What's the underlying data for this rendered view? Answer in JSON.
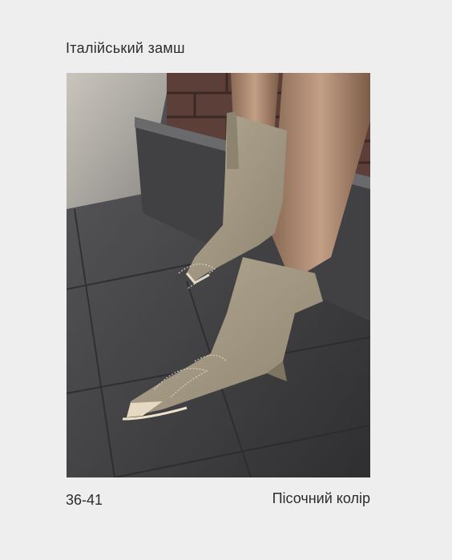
{
  "title": "Італійський замш",
  "sizes": "36-41",
  "color_name": "Пісочний колір",
  "colors": {
    "background": "#eeeeee",
    "text": "#2c2c2c",
    "suede": "#a49a84",
    "pavement": "#3e3e40"
  }
}
